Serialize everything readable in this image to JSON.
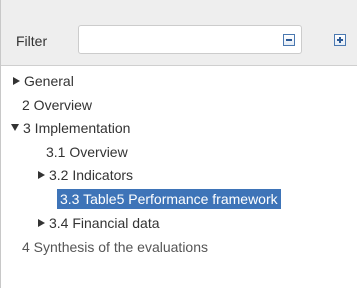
{
  "filter": {
    "label": "Filter",
    "value": "",
    "placeholder": ""
  },
  "toolbar": {
    "collapse_icon": "collapse-all-icon",
    "expand_icon": "expand-all-icon"
  },
  "tree": {
    "items": [
      {
        "label": "General",
        "expander": "collapsed"
      },
      {
        "label": "2 Overview",
        "expander": "none"
      },
      {
        "label": "3 Implementation",
        "expander": "expanded"
      },
      {
        "label": "3.1 Overview",
        "expander": "none"
      },
      {
        "label": "3.2 Indicators",
        "expander": "collapsed"
      },
      {
        "label": "3.3 Table5 Performance framework",
        "expander": "none",
        "selected": true
      },
      {
        "label": "3.4 Financial data",
        "expander": "collapsed"
      },
      {
        "label": "4 Synthesis of the evaluations",
        "expander": "none"
      }
    ]
  },
  "colors": {
    "selection_background": "#3e74b8",
    "filter_bar_background": "#eeeeee",
    "icon_border": "#4a78b0"
  }
}
